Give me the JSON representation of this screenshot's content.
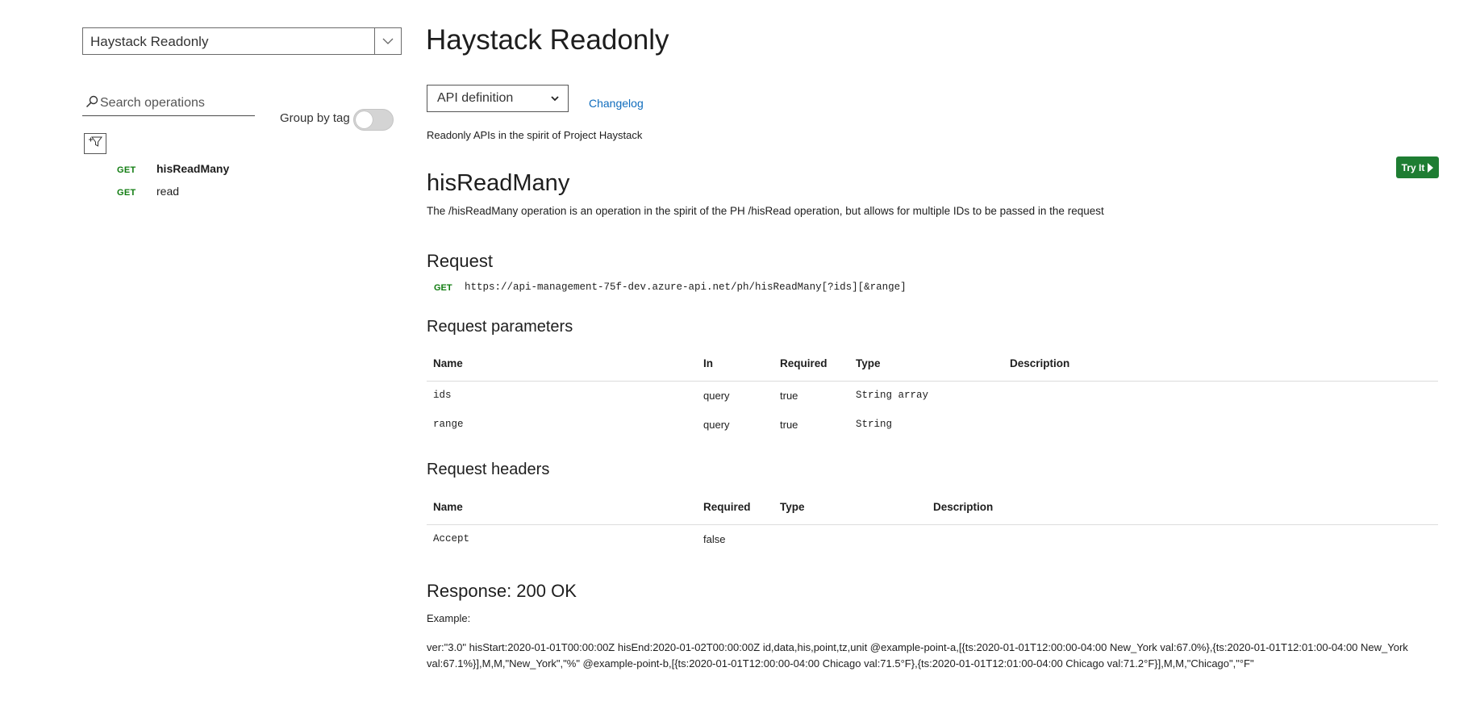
{
  "sidebar": {
    "api_selector": {
      "value": "Haystack Readonly"
    },
    "search": {
      "placeholder": "Search operations"
    },
    "group_by_tag": {
      "label": "Group by tag",
      "enabled": false
    },
    "operations": [
      {
        "method": "GET",
        "name": "hisReadMany",
        "active": true
      },
      {
        "method": "GET",
        "name": "read",
        "active": false
      }
    ]
  },
  "main": {
    "title": "Haystack Readonly",
    "definition_select": {
      "value": "API definition"
    },
    "changelog_label": "Changelog",
    "api_description": "Readonly APIs in the spirit of Project Haystack",
    "try_it_label": "Try It",
    "operation": {
      "name": "hisReadMany",
      "description": "The /hisReadMany operation is an operation in the spirit of the PH /hisRead operation, but allows for multiple IDs to be passed in the request"
    },
    "request": {
      "heading": "Request",
      "method": "GET",
      "url": "https://api-management-75f-dev.azure-api.net/ph/hisReadMany[?ids][&range]"
    },
    "request_parameters": {
      "heading": "Request parameters",
      "columns": [
        "Name",
        "In",
        "Required",
        "Type",
        "Description"
      ],
      "rows": [
        {
          "name": "ids",
          "in": "query",
          "required": "true",
          "type": "String array",
          "description": ""
        },
        {
          "name": "range",
          "in": "query",
          "required": "true",
          "type": "String",
          "description": ""
        }
      ]
    },
    "request_headers": {
      "heading": "Request headers",
      "columns": [
        "Name",
        "Required",
        "Type",
        "Description"
      ],
      "rows": [
        {
          "name": "Accept",
          "required": "false",
          "type": "",
          "description": ""
        }
      ]
    },
    "response": {
      "heading": "Response: 200 OK",
      "example_label": "Example:",
      "example_body": "ver:\"3.0\" hisStart:2020-01-01T00:00:00Z hisEnd:2020-01-02T00:00:00Z id,data,his,point,tz,unit @example-point-a,[{ts:2020-01-01T12:00:00-04:00 New_York val:67.0%},{ts:2020-01-01T12:01:00-04:00 New_York val:67.1%}],M,M,\"New_York\",\"%\" @example-point-b,[{ts:2020-01-01T12:00:00-04:00 Chicago val:71.5°F},{ts:2020-01-01T12:01:00-04:00 Chicago val:71.2°F}],M,M,\"Chicago\",\"°F\""
    }
  },
  "colors": {
    "get_method": "#107c10",
    "link": "#0f6cbd",
    "try_button": "#1e7d32"
  }
}
